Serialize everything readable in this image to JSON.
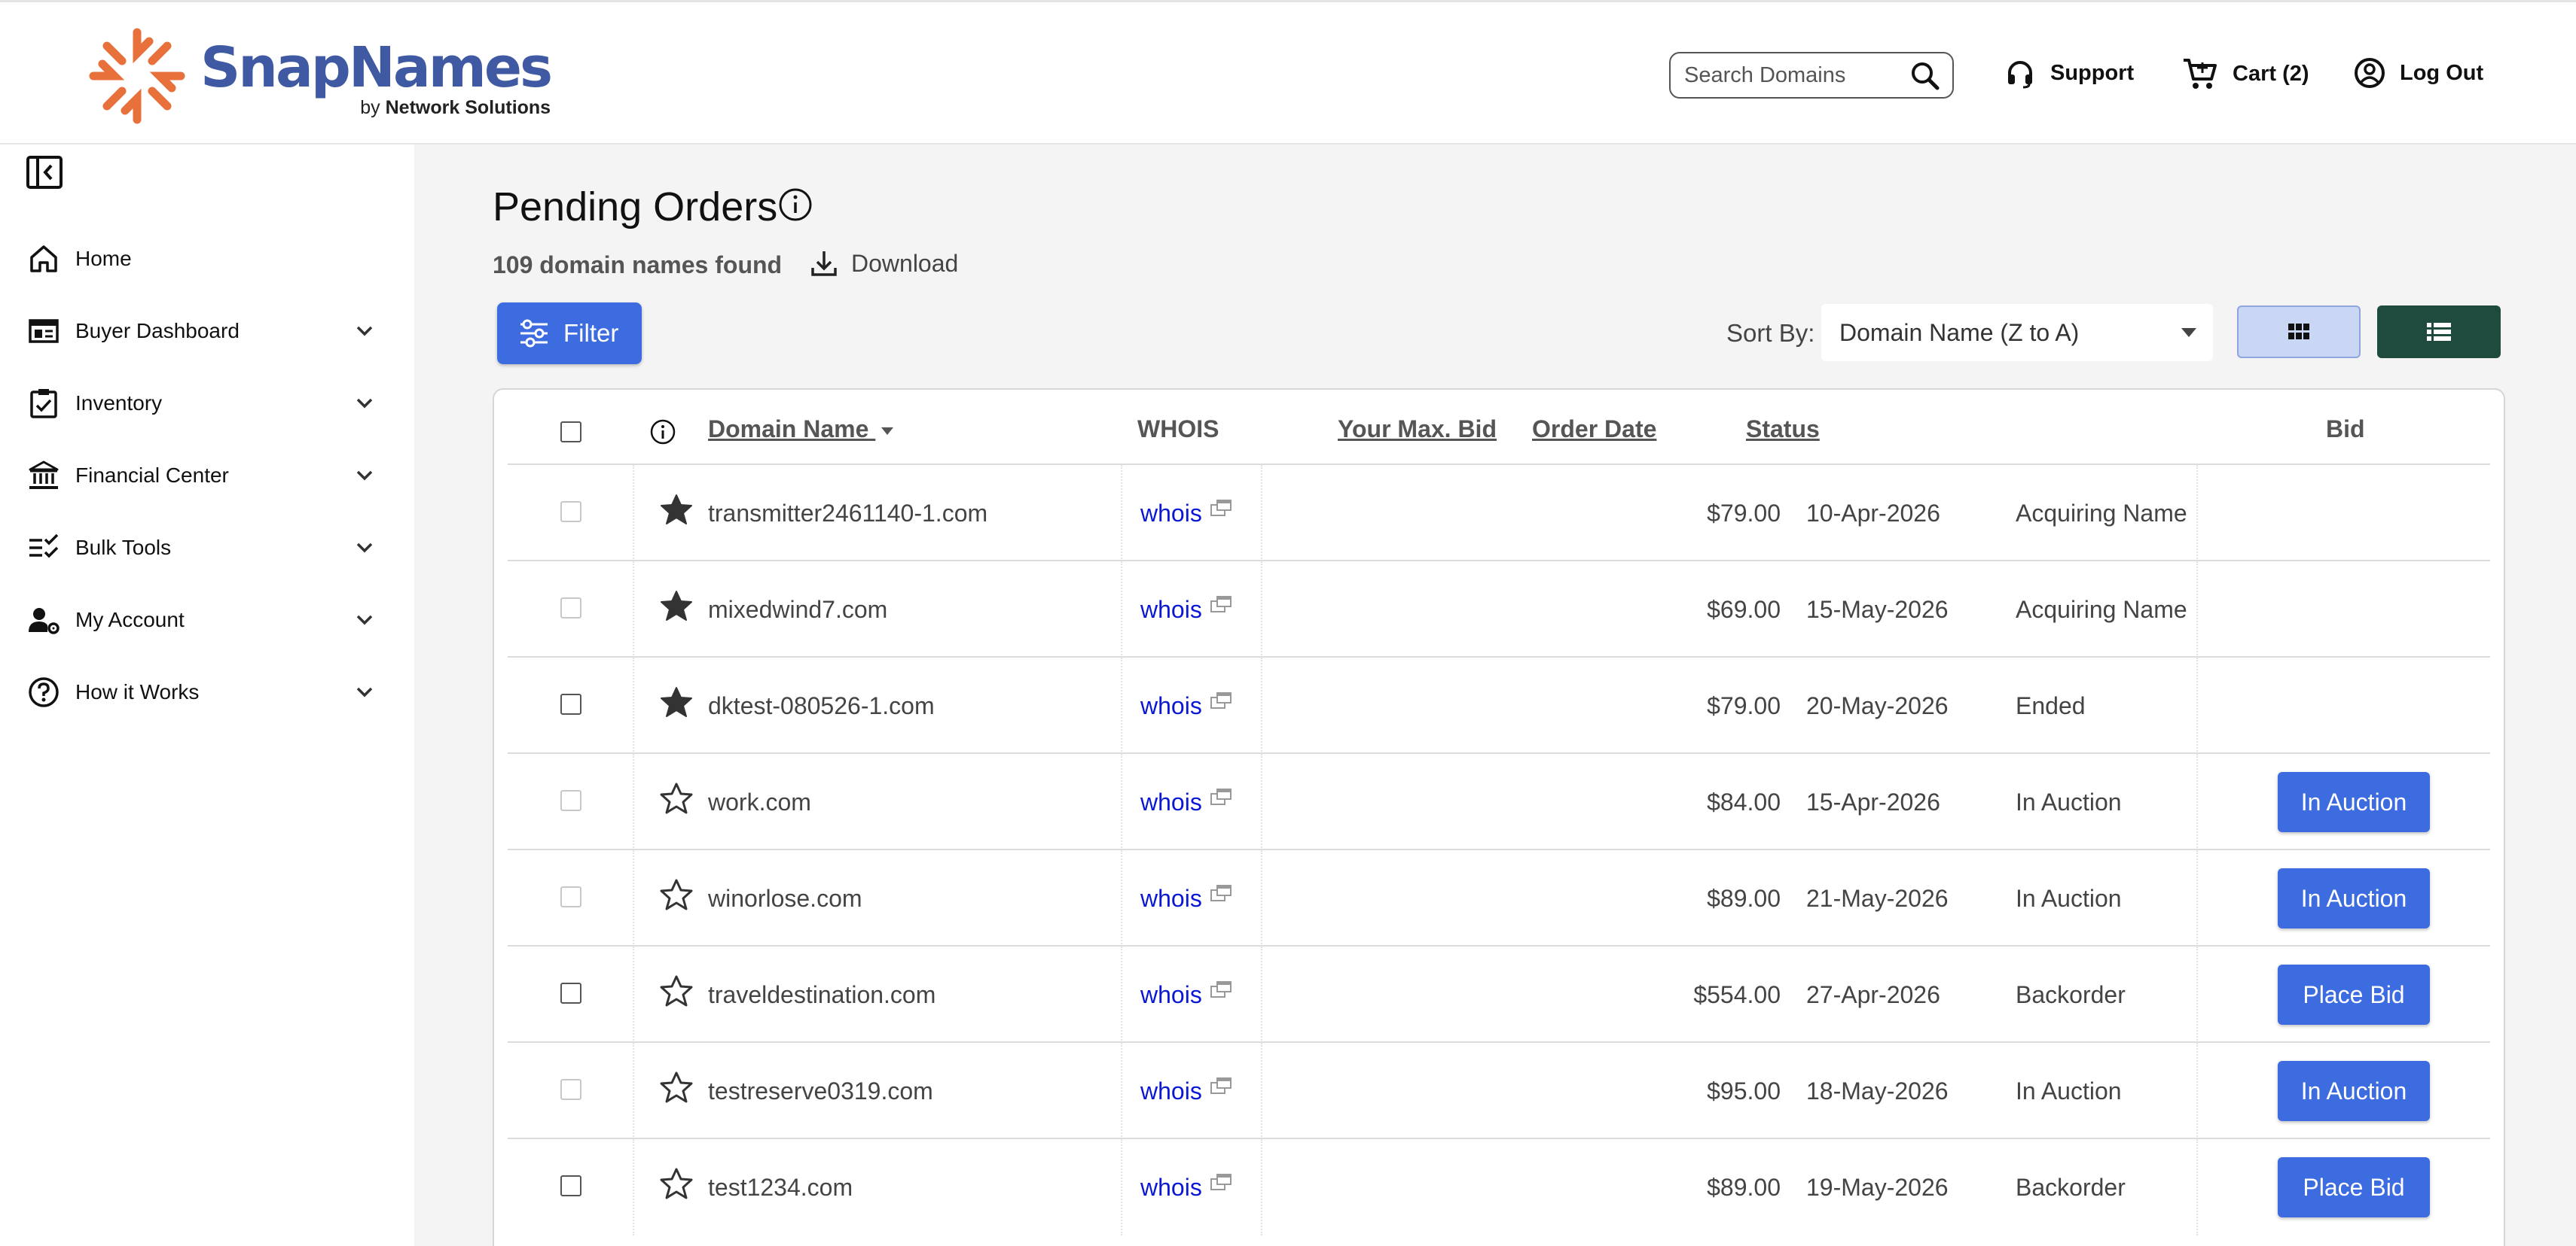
{
  "header": {
    "logo_name": "SnapNames",
    "logo_sub_prefix": "by",
    "logo_sub_brand": "Network Solutions",
    "search_placeholder": "Search Domains",
    "support_label": "Support",
    "cart_label": "Cart (2)",
    "logout_label": "Log Out"
  },
  "sidebar": {
    "items": [
      {
        "label": "Home",
        "icon": "home-icon",
        "has_chevron": false
      },
      {
        "label": "Buyer Dashboard",
        "icon": "dashboard-icon",
        "has_chevron": true
      },
      {
        "label": "Inventory",
        "icon": "clipboard-check-icon",
        "has_chevron": true
      },
      {
        "label": "Financial Center",
        "icon": "bank-icon",
        "has_chevron": true
      },
      {
        "label": "Bulk Tools",
        "icon": "checklist-icon",
        "has_chevron": true
      },
      {
        "label": "My Account",
        "icon": "user-gear-icon",
        "has_chevron": true
      },
      {
        "label": "How it Works",
        "icon": "help-circle-icon",
        "has_chevron": true
      }
    ]
  },
  "main": {
    "title": "Pending Orders",
    "found_text": "109 domain names found",
    "download_label": "Download",
    "filter_label": "Filter",
    "sort_label": "Sort By:",
    "sort_value": "Domain Name (Z to A)"
  },
  "table": {
    "headers": {
      "domain": "Domain Name",
      "whois": "WHOIS",
      "max_bid": "Your Max. Bid",
      "order_date": "Order Date",
      "status": "Status",
      "bid": "Bid"
    },
    "rows": [
      {
        "domain": "transmitter2461140-1.com",
        "whois": "whois",
        "max_bid": "$79.00",
        "order_date": "10-Apr-2026",
        "status": "Acquiring Name",
        "starred": true,
        "checkbox_enabled": false,
        "action": ""
      },
      {
        "domain": "mixedwind7.com",
        "whois": "whois",
        "max_bid": "$69.00",
        "order_date": "15-May-2026",
        "status": "Acquiring Name",
        "starred": true,
        "checkbox_enabled": false,
        "action": ""
      },
      {
        "domain": "dktest-080526-1.com",
        "whois": "whois",
        "max_bid": "$79.00",
        "order_date": "20-May-2026",
        "status": "Ended",
        "starred": true,
        "checkbox_enabled": true,
        "action": ""
      },
      {
        "domain": "work.com",
        "whois": "whois",
        "max_bid": "$84.00",
        "order_date": "15-Apr-2026",
        "status": "In Auction",
        "starred": false,
        "checkbox_enabled": false,
        "action": "In Auction"
      },
      {
        "domain": "winorlose.com",
        "whois": "whois",
        "max_bid": "$89.00",
        "order_date": "21-May-2026",
        "status": "In Auction",
        "starred": false,
        "checkbox_enabled": false,
        "action": "In Auction"
      },
      {
        "domain": "traveldestination.com",
        "whois": "whois",
        "max_bid": "$554.00",
        "order_date": "27-Apr-2026",
        "status": "Backorder",
        "starred": false,
        "checkbox_enabled": true,
        "action": "Place Bid"
      },
      {
        "domain": "testreserve0319.com",
        "whois": "whois",
        "max_bid": "$95.00",
        "order_date": "18-May-2026",
        "status": "In Auction",
        "starred": false,
        "checkbox_enabled": false,
        "action": "In Auction"
      },
      {
        "domain": "test1234.com",
        "whois": "whois",
        "max_bid": "$89.00",
        "order_date": "19-May-2026",
        "status": "Backorder",
        "starred": false,
        "checkbox_enabled": true,
        "action": "Place Bid"
      }
    ]
  },
  "colors": {
    "brand_blue": "#3f5aa3",
    "brand_orange": "#e8703a",
    "primary_button": "#3d6be0",
    "whois_link": "#0a18d6",
    "list_view_active": "#1f4a3e"
  }
}
